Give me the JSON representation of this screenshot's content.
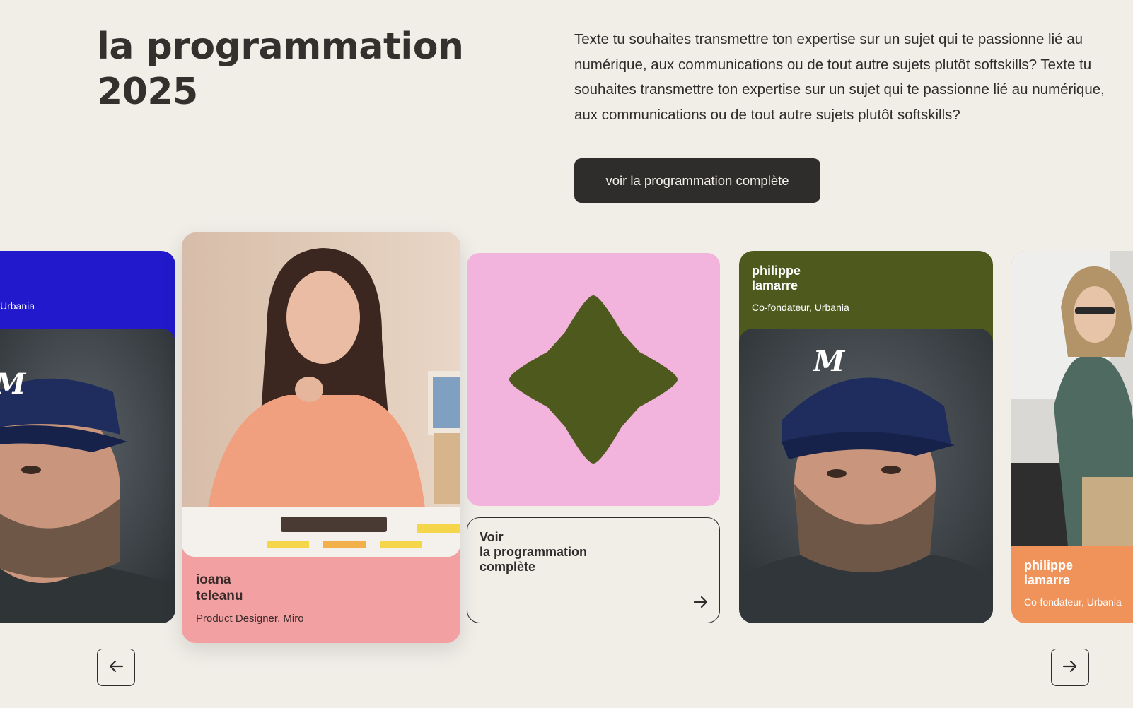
{
  "header": {
    "title": "la programmation 2025",
    "intro": "Texte tu souhaites transmettre ton expertise sur un sujet qui te passionne lié au numérique, aux communications ou de tout autre sujets plutôt softskills? Texte tu souhaites transmettre ton expertise sur un sujet qui te passionne lié au numérique, aux communications ou de tout autre sujets plutôt softskills?",
    "cta_label": "voir la programmation complète"
  },
  "carousel": {
    "cards": [
      {
        "role": "Urbania",
        "color": "#2219cc"
      },
      {
        "name": "ioana\nteleanu",
        "role": "Product Designer, Miro",
        "color": "#f2a0a2"
      },
      {
        "color": "#f2b4dc",
        "shape_color": "#4e591e",
        "link_label": "Voir\nla programmation\ncomplète"
      },
      {
        "name": "philippe\nlamarre",
        "role": "Co-fondateur, Urbania",
        "color": "#4e591e"
      },
      {
        "name": "philippe\nlamarre",
        "role": "Co-fondateur, Urbania",
        "color": "#f0935a"
      }
    ]
  },
  "nav": {
    "prev_icon": "arrow-left-icon",
    "next_icon": "arrow-right-icon"
  }
}
